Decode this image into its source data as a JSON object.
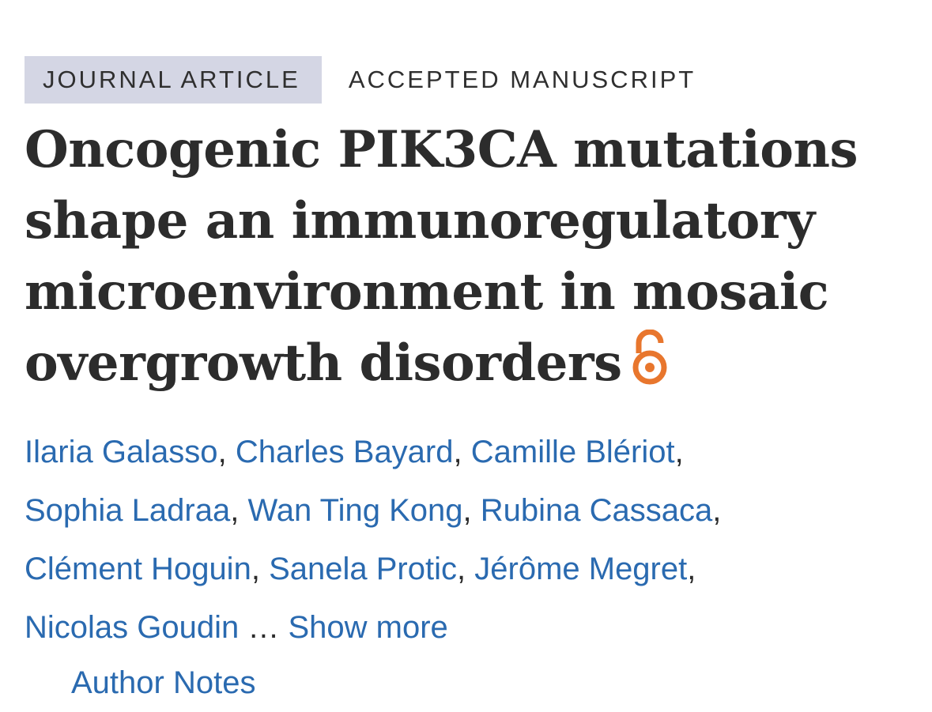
{
  "article": {
    "type_badge": "JOURNAL ARTICLE",
    "status": "ACCEPTED MANUSCRIPT",
    "title": "Oncogenic PIK3CA mutations shape an immunoregulatory microenvironment in mosaic overgrowth disorders",
    "open_access_icon": "open-access-lock-icon",
    "colors": {
      "badge_background": "#d4d6e4",
      "link": "#2a6ab0",
      "open_access": "#e8762d",
      "text": "#2c2c2c"
    }
  },
  "authors": {
    "list": [
      "Ilaria Galasso",
      "Charles Bayard",
      "Camille Blériot",
      "Sophia Ladraa",
      "Wan Ting Kong",
      "Rubina Cassaca",
      "Clément Hoguin",
      "Sanela Protic",
      "Jérôme Megret",
      "Nicolas Goudin"
    ],
    "separator": ",",
    "ellipsis": "…",
    "show_more_label": "Show more",
    "author_notes_label": "Author Notes"
  }
}
